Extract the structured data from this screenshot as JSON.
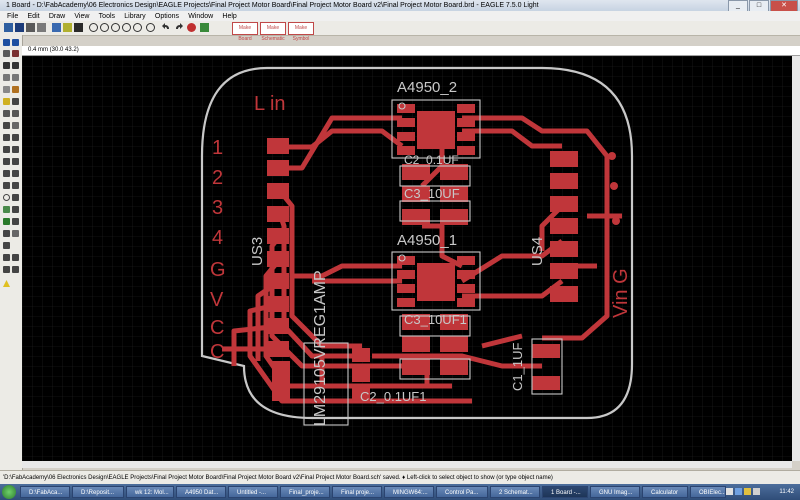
{
  "window": {
    "title": "1 Board - D:\\FabAcademy\\06 Electronics Design\\EAGLE Projects\\Final Project Motor Board\\Final Project Motor Board v2\\Final Project Motor Board.brd - EAGLE 7.5.0 Light"
  },
  "menu": [
    "File",
    "Edit",
    "Draw",
    "View",
    "Tools",
    "Library",
    "Options",
    "Window",
    "Help"
  ],
  "toolbar_buttons": [
    "Make Board",
    "Make Schematic",
    "Make Symbol"
  ],
  "coord": "0.4 mm (30.0 43.2)",
  "board": {
    "labels": {
      "l_in": "L in",
      "pin1": "1",
      "pin2": "2",
      "pin3": "3",
      "pin4": "4",
      "g": "G",
      "v": "V",
      "c1": "C",
      "c2": "C",
      "vin_g": "Vin G",
      "a4950_2": "A4950_2",
      "a4950_1": "A4950_1",
      "c2_top": "C2_0.1UF",
      "c3_top": "C3_10UF",
      "c3_bottom": "C3_10UF1",
      "c2_bottom": "C2_0.1UF1",
      "c1_1uf": "C1_1UF",
      "us3": "US3",
      "us4": "US4",
      "lm29105": "LM29105VREG1AMP"
    },
    "colors": {
      "copper": "#c0363a",
      "silk": "#c8c8c8",
      "background": "#000000",
      "grid": "#2a2a2a"
    }
  },
  "status": {
    "text": "'D:\\FabAcademy\\06 Electronics Design\\EAGLE Projects\\Final Project Motor Board\\Final Project Motor Board v2\\Final Project Motor Board.sch' saved.  ♦ Left-click to select object to show (or type object name)"
  },
  "taskbar": {
    "items": [
      "D:\\FabAca...",
      "D:\\Reposit...",
      "wk 12: Mol...",
      "A4950 Dat...",
      "Untitled -...",
      "Final_proje...",
      "Final proje...",
      "MINGW64:...",
      "Control Pa...",
      "2 Schemat...",
      "1 Board -...",
      "GNU Imag...",
      "Calculator",
      "OBIElec..."
    ],
    "clock": "11:42"
  }
}
